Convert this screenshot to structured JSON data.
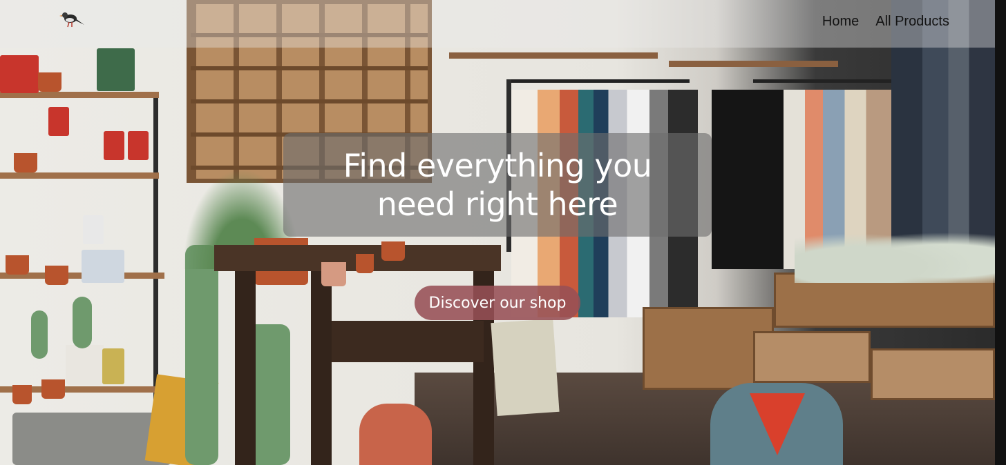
{
  "nav": {
    "logo_icon": "bird-logo-icon",
    "items": [
      {
        "label": "Home"
      },
      {
        "label": "All Products"
      }
    ]
  },
  "hero": {
    "headline": "Find everything you need right here",
    "cta_label": "Discover our shop"
  },
  "colors": {
    "overlay_box": "#6e6e6e",
    "cta_bg": "#965055",
    "nav_text": "#141414"
  }
}
